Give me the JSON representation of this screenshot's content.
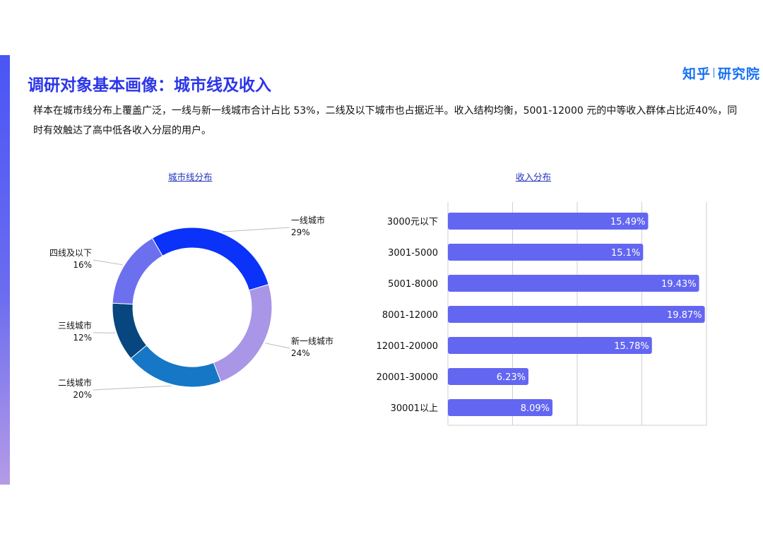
{
  "brand": {
    "part1": "知乎",
    "part2": "研究院"
  },
  "page_title": "调研对象基本画像：城市线及收入",
  "subtitle": "样本在城市线分布上覆盖广泛，一线与新一线城市合计占比 53%，二线及以下城市也占据近半。收入结构均衡，5001-12000 元的中等收入群体占比近40%，同时有效触达了高中低各收入分层的用户。",
  "colors": {
    "accent": "#2b36e8",
    "bar": "#6366f1",
    "brand": "#1772f6"
  },
  "chart_data": [
    {
      "type": "pie",
      "title": "城市线分布",
      "donut": true,
      "slices": [
        {
          "label": "一线城市",
          "value": 29,
          "value_label": "29%",
          "color": "#0a32f8"
        },
        {
          "label": "新一线城市",
          "value": 24,
          "value_label": "24%",
          "color": "#a996e6"
        },
        {
          "label": "二线城市",
          "value": 20,
          "value_label": "20%",
          "color": "#1577c6"
        },
        {
          "label": "三线城市",
          "value": 12,
          "value_label": "12%",
          "color": "#07467e"
        },
        {
          "label": "四线及以下",
          "value": 16,
          "value_label": "16%",
          "color": "#6c70ee"
        }
      ]
    },
    {
      "type": "bar",
      "orientation": "horizontal",
      "title": "收入分布",
      "categories": [
        "3000元以下",
        "3001-5000",
        "5001-8000",
        "8001-12000",
        "12001-20000",
        "20001-30000",
        "30001以上"
      ],
      "values": [
        15.49,
        15.1,
        19.43,
        19.87,
        15.78,
        6.23,
        8.09
      ],
      "value_labels": [
        "15.49%",
        "15.1%",
        "19.43%",
        "19.87%",
        "15.78%",
        "6.23%",
        "8.09%"
      ],
      "xlim": [
        0,
        20
      ],
      "grid": true,
      "color": "#6366f1"
    }
  ]
}
